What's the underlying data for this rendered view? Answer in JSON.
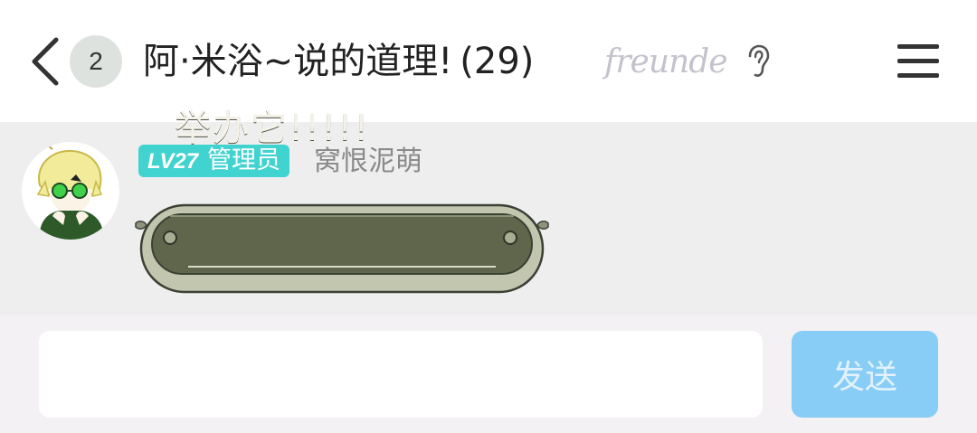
{
  "header": {
    "unread_count": "2",
    "title": "阿·米浴~说的道理!",
    "member_count": "(29)",
    "brand_text": "freunde",
    "icons": [
      "back-icon",
      "ear-icon",
      "menu-icon"
    ]
  },
  "message": {
    "level": "LV27",
    "role": "管理员",
    "sender": "窝恨泥萌",
    "text": "举办它!!!!!"
  },
  "composer": {
    "placeholder": "",
    "send_label": "发送"
  },
  "colors": {
    "badge": "#41d3cf",
    "send_button": "#88cdf6",
    "chat_background": "#eeeeee"
  }
}
